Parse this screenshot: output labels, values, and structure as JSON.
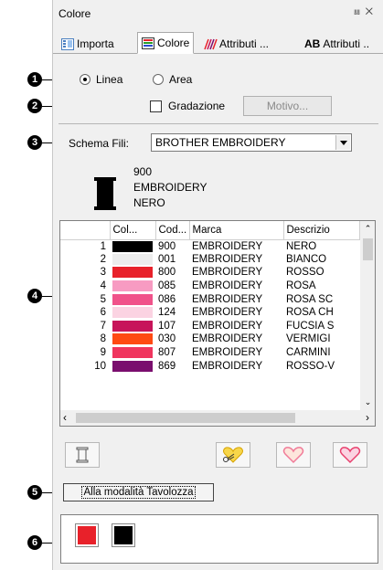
{
  "window": {
    "title": "Colore",
    "pin_glyph": "⩏",
    "close_glyph": "✕"
  },
  "tabs": [
    {
      "label": "Importa",
      "icon": "import-icon"
    },
    {
      "label": "Colore",
      "icon": "color-icon"
    },
    {
      "label": "Attributi ...",
      "icon": "stitch-attributes-icon"
    },
    {
      "label": "Attributi ..",
      "prefix": "AB",
      "icon": "text-attributes-icon"
    }
  ],
  "mode": {
    "line_label": "Linea",
    "area_label": "Area",
    "selected": "Linea"
  },
  "gradient": {
    "label": "Gradazione",
    "checked": false,
    "pattern_button": "Motivo..."
  },
  "thread_chart": {
    "label": "Schema Fili:",
    "value": "BROTHER EMBROIDERY"
  },
  "current_thread": {
    "code": "900",
    "brand": "EMBROIDERY",
    "name": "NERO",
    "color": "#000000"
  },
  "thread_table": {
    "columns": [
      "",
      "Col...",
      "Cod...",
      "Marca",
      "Descrizio"
    ],
    "rows": [
      {
        "n": "1",
        "color": "#000000",
        "code": "900",
        "brand": "EMBROIDERY",
        "desc": "NERO"
      },
      {
        "n": "2",
        "color": "#ececec",
        "code": "001",
        "brand": "EMBROIDERY",
        "desc": "BIANCO"
      },
      {
        "n": "3",
        "color": "#e8212a",
        "code": "800",
        "brand": "EMBROIDERY",
        "desc": "ROSSO"
      },
      {
        "n": "4",
        "color": "#f79bc2",
        "code": "085",
        "brand": "EMBROIDERY",
        "desc": "ROSA"
      },
      {
        "n": "5",
        "color": "#f0528a",
        "code": "086",
        "brand": "EMBROIDERY",
        "desc": "ROSA SC"
      },
      {
        "n": "6",
        "color": "#fbd3e2",
        "code": "124",
        "brand": "EMBROIDERY",
        "desc": "ROSA CH"
      },
      {
        "n": "7",
        "color": "#c7145a",
        "code": "107",
        "brand": "EMBROIDERY",
        "desc": "FUCSIA S"
      },
      {
        "n": "8",
        "color": "#ff4a12",
        "code": "030",
        "brand": "EMBROIDERY",
        "desc": "VERMIGI"
      },
      {
        "n": "9",
        "color": "#f0355e",
        "code": "807",
        "brand": "EMBROIDERY",
        "desc": "CARMINI"
      },
      {
        "n": "10",
        "color": "#7a0e6e",
        "code": "869",
        "brand": "EMBROIDERY",
        "desc": "ROSSO-V"
      }
    ]
  },
  "tools": [
    "spool-icon",
    "scissors-heart-icon",
    "outline-heart-icon",
    "heart-icon"
  ],
  "palette_button": "Alla modalità Tavolozza",
  "recent_colors": [
    "#e8212a",
    "#000000"
  ],
  "callouts": [
    "1",
    "2",
    "3",
    "4",
    "5",
    "6"
  ]
}
